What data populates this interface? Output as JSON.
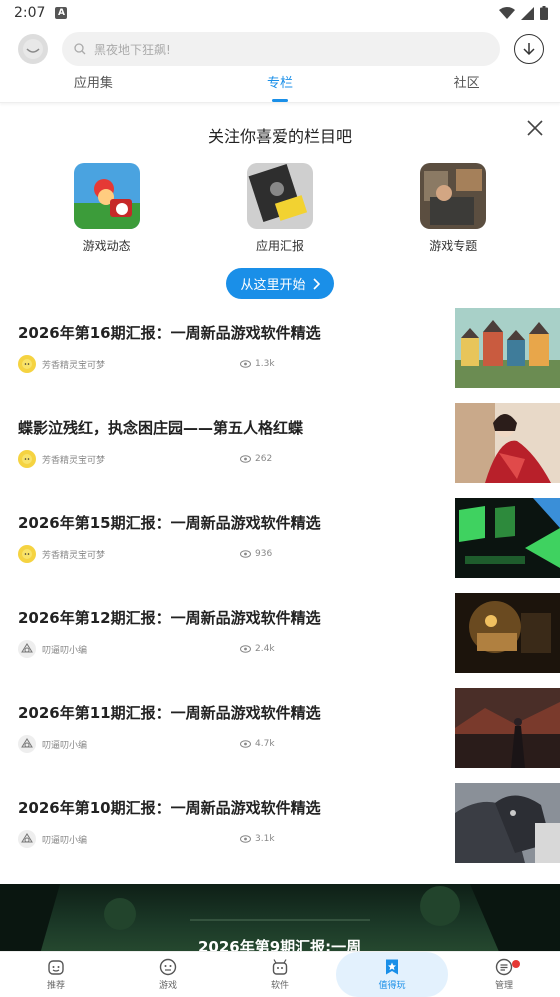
{
  "status_bar": {
    "time": "2:07"
  },
  "search": {
    "placeholder": "黑夜地下狂飙!"
  },
  "tabs": [
    {
      "label": "应用集"
    },
    {
      "label": "专栏",
      "active": true
    },
    {
      "label": "社区"
    }
  ],
  "follow_panel": {
    "title": "关注你喜爱的栏目吧",
    "items": [
      {
        "label": "游戏动态"
      },
      {
        "label": "应用汇报"
      },
      {
        "label": "游戏专题"
      }
    ],
    "start_button": "从这里开始"
  },
  "articles": [
    {
      "title": "2026年第16期汇报：一周新品游戏软件精选",
      "author": "芳香精灵宝可梦",
      "views": "1.3k"
    },
    {
      "title": "蝶影泣残红，执念困庄园——第五人格红蝶",
      "author": "芳香精灵宝可梦",
      "views": "262"
    },
    {
      "title": "2026年第15期汇报：一周新品游戏软件精选",
      "author": "芳香精灵宝可梦",
      "views": "936"
    },
    {
      "title": "2026年第12期汇报：一周新品游戏软件精选",
      "author": "叨逼叨小编",
      "views": "2.4k"
    },
    {
      "title": "2026年第11期汇报：一周新品游戏软件精选",
      "author": "叨逼叨小编",
      "views": "4.7k"
    },
    {
      "title": "2026年第10期汇报：一周新品游戏软件精选",
      "author": "叨逼叨小编",
      "views": "3.1k"
    }
  ],
  "banner": {
    "title": "2026年第9期汇报:一周"
  },
  "bottom_nav": [
    {
      "label": "推荐",
      "icon": "recommend-icon"
    },
    {
      "label": "游戏",
      "icon": "game-icon"
    },
    {
      "label": "软件",
      "icon": "software-icon"
    },
    {
      "label": "值得玩",
      "icon": "star-icon",
      "active": true
    },
    {
      "label": "管理",
      "icon": "manage-icon"
    }
  ],
  "colors": {
    "accent": "#1a8fe8",
    "badge": "#e53935"
  }
}
